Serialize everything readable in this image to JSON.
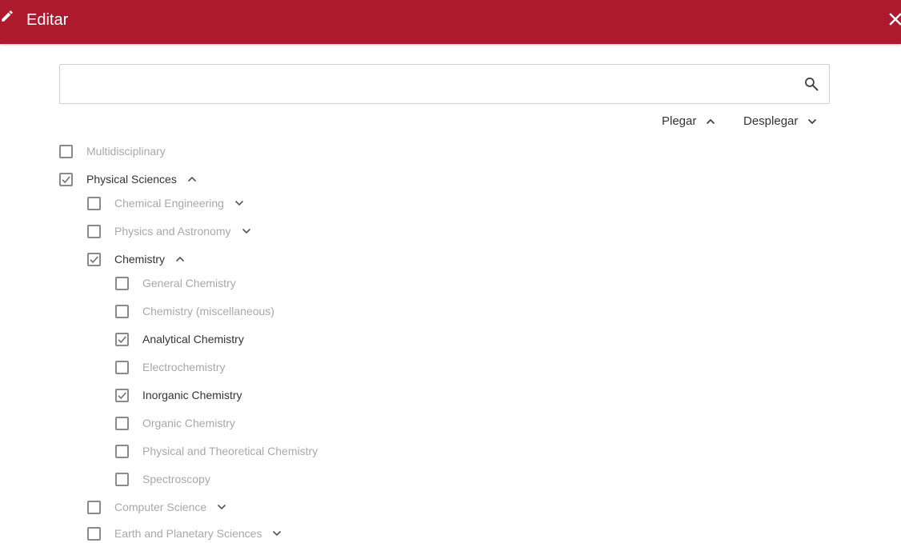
{
  "header": {
    "title": "Editar",
    "background_color": "#ad1a2d",
    "edit_icon": "pencil-icon",
    "close_icon": "close-icon"
  },
  "search": {
    "value": "",
    "placeholder": "",
    "icon": "search-icon"
  },
  "toolbar": {
    "collapse_label": "Plegar",
    "expand_label": "Desplegar"
  },
  "tree": [
    {
      "label": "Multidisciplinary",
      "level": 0,
      "checked": false,
      "chevron": "none"
    },
    {
      "label": "Physical Sciences",
      "level": 0,
      "checked": true,
      "chevron": "up"
    },
    {
      "label": "Chemical Engineering",
      "level": 1,
      "checked": false,
      "chevron": "down"
    },
    {
      "label": "Physics and Astronomy",
      "level": 1,
      "checked": false,
      "chevron": "down"
    },
    {
      "label": "Chemistry",
      "level": 1,
      "checked": true,
      "chevron": "up"
    },
    {
      "label": "General Chemistry",
      "level": 2,
      "checked": false,
      "chevron": "none"
    },
    {
      "label": "Chemistry (miscellaneous)",
      "level": 2,
      "checked": false,
      "chevron": "none"
    },
    {
      "label": "Analytical Chemistry",
      "level": 2,
      "checked": true,
      "chevron": "none"
    },
    {
      "label": "Electrochemistry",
      "level": 2,
      "checked": false,
      "chevron": "none"
    },
    {
      "label": "Inorganic Chemistry",
      "level": 2,
      "checked": true,
      "chevron": "none"
    },
    {
      "label": "Organic Chemistry",
      "level": 2,
      "checked": false,
      "chevron": "none"
    },
    {
      "label": "Physical and Theoretical Chemistry",
      "level": 2,
      "checked": false,
      "chevron": "none"
    },
    {
      "label": "Spectroscopy",
      "level": 2,
      "checked": false,
      "chevron": "none"
    },
    {
      "label": "Computer Science",
      "level": 1,
      "checked": false,
      "chevron": "down"
    },
    {
      "label": "Earth and Planetary Sciences",
      "level": 1,
      "checked": false,
      "chevron": "down"
    }
  ]
}
